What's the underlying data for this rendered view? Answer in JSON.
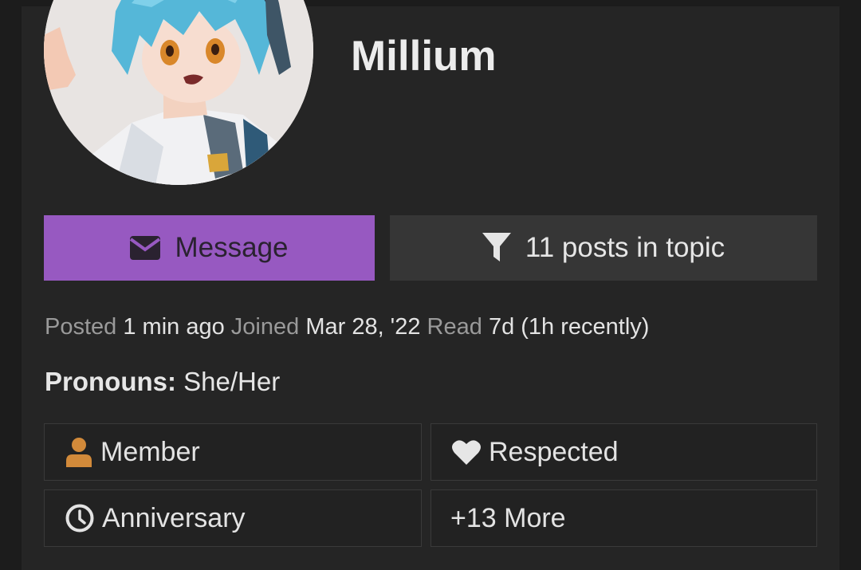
{
  "profile": {
    "username": "Millium",
    "avatar_icon": "anime-avatar"
  },
  "actions": {
    "message_label": "Message",
    "message_icon": "envelope-icon",
    "filter_label": "11 posts in topic",
    "filter_icon": "filter-icon"
  },
  "meta": {
    "posted_label": "Posted",
    "posted_value": "1 min ago",
    "joined_label": "Joined",
    "joined_value": "Mar 28, '22",
    "read_label": "Read",
    "read_value": "7d (1h recently)"
  },
  "pronouns": {
    "label": "Pronouns:",
    "value": "She/Her"
  },
  "badges": [
    {
      "label": "Member",
      "icon": "user-icon"
    },
    {
      "label": "Respected",
      "icon": "heart-icon"
    },
    {
      "label": "Anniversary",
      "icon": "clock-icon"
    },
    {
      "label": "+13 More",
      "icon": ""
    }
  ],
  "colors": {
    "accent": "#9759c1",
    "background": "#1c1c1c",
    "card": "#252525",
    "member_icon": "#d28a3a"
  }
}
